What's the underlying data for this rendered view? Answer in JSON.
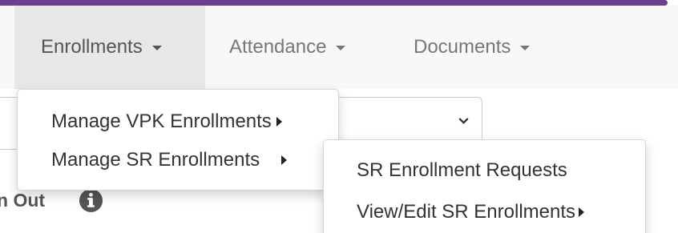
{
  "navbar": {
    "items": [
      {
        "label": "Enrollments",
        "active": true
      },
      {
        "label": "Attendance",
        "active": false
      },
      {
        "label": "Documents",
        "active": false
      }
    ]
  },
  "enrollments_menu": {
    "items": [
      {
        "label": "Manage VPK Enrollments",
        "has_submenu": true
      },
      {
        "label": "Manage SR Enrollments",
        "has_submenu": true
      }
    ]
  },
  "sr_submenu": {
    "items": [
      {
        "label": "SR Enrollment Requests",
        "has_submenu": false
      },
      {
        "label": "View/Edit SR Enrollments",
        "has_submenu": true
      }
    ]
  },
  "background": {
    "section_label": "n Out",
    "info_icon": "info-circle-icon",
    "select_icon": "chevron-down-icon"
  },
  "colors": {
    "accent_bar": "#6f3f8f",
    "navbar_bg": "#f8f8f8",
    "active_nav_bg": "#e7e7e7",
    "nav_text": "#777777",
    "menu_text": "#333333",
    "info_icon": "#555555"
  }
}
